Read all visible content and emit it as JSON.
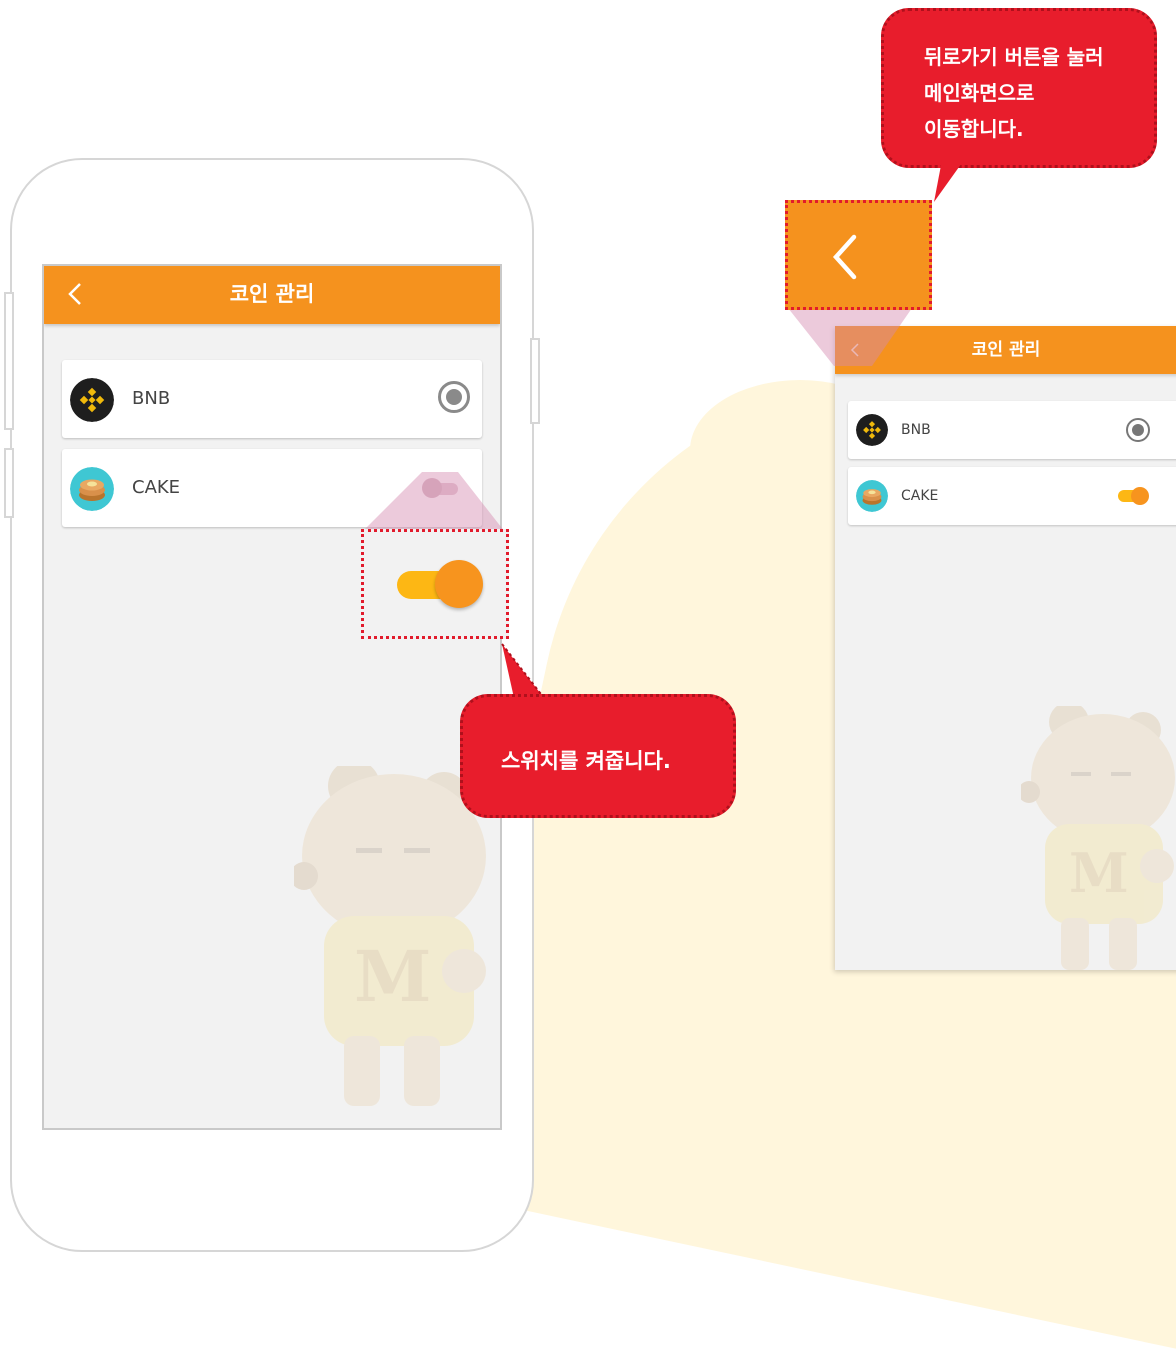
{
  "screen": {
    "title": "코인 관리",
    "coins": [
      {
        "name": "BNB",
        "control": "radio",
        "selected": true
      },
      {
        "name": "CAKE",
        "control": "switch",
        "on": false
      }
    ]
  },
  "preview": {
    "title": "코인 관리",
    "coins": [
      {
        "name": "BNB",
        "control": "radio",
        "selected": true
      },
      {
        "name": "CAKE",
        "control": "switch",
        "on": true
      }
    ]
  },
  "callouts": {
    "switch": "스위치를 켜줍니다.",
    "back_line1": "뒤로가기 버튼을 눌러",
    "back_line2": "메인화면으로",
    "back_line3": "이동합니다."
  },
  "colors": {
    "appbar": "#f5921e",
    "switch_on_track": "#fdb714",
    "switch_on_thumb": "#f7941e",
    "callout": "#e81d2c"
  },
  "icons": [
    "chevron-left-icon",
    "bnb-coin-icon",
    "cake-coin-icon",
    "radio-selected-icon",
    "toggle-switch"
  ]
}
